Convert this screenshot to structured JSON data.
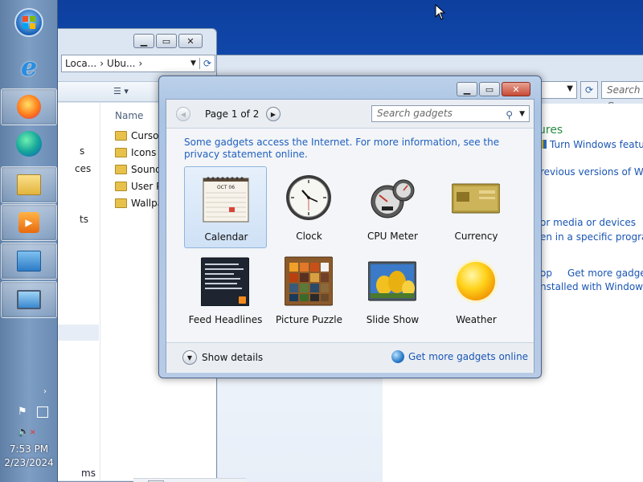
{
  "taskbar": {
    "items": [
      {
        "name": "start-orb"
      },
      {
        "name": "internet-explorer"
      },
      {
        "name": "firefox"
      },
      {
        "name": "edge"
      },
      {
        "name": "file-explorer"
      },
      {
        "name": "media-player"
      },
      {
        "name": "control-panel"
      },
      {
        "name": "remote-desktop"
      }
    ],
    "time": "7:53 PM",
    "date": "2/23/2024"
  },
  "explorer_left": {
    "address_parts": [
      "Loca...",
      "Ubu..."
    ],
    "column_header": "Name",
    "nav_fragments": [
      "s",
      "ces",
      "ts"
    ],
    "folders": [
      "Cursor",
      "Icons",
      "Sound",
      "User P",
      "Wallpa"
    ],
    "status_fragment": "ms"
  },
  "control_panel": {
    "search_placeholder": "Search C",
    "heading_fragment": "ures",
    "links": [
      "Turn Windows features",
      "revious versions of Wind",
      "or media or devices",
      "en in a specific program",
      "op",
      "Get more gadgets",
      "nstalled with Windows"
    ]
  },
  "gadgets": {
    "pager": {
      "text": "Page 1 of 2"
    },
    "search_placeholder": "Search gadgets",
    "info": "Some gadgets access the Internet.  For more information, see the privacy statement online.",
    "items": [
      {
        "label": "Calendar",
        "selected": true
      },
      {
        "label": "Clock",
        "selected": false
      },
      {
        "label": "CPU Meter",
        "selected": false
      },
      {
        "label": "Currency",
        "selected": false
      },
      {
        "label": "Feed Headlines",
        "selected": false
      },
      {
        "label": "Picture Puzzle",
        "selected": false
      },
      {
        "label": "Slide Show",
        "selected": false
      },
      {
        "label": "Weather",
        "selected": false
      }
    ],
    "calendar_month": "OCT 06",
    "show_details": "Show details",
    "more_online": "Get more gadgets online"
  },
  "colors": {
    "link": "#1a55b4",
    "info_text": "#1f5fbf",
    "desktop": "#1a5cc8"
  }
}
